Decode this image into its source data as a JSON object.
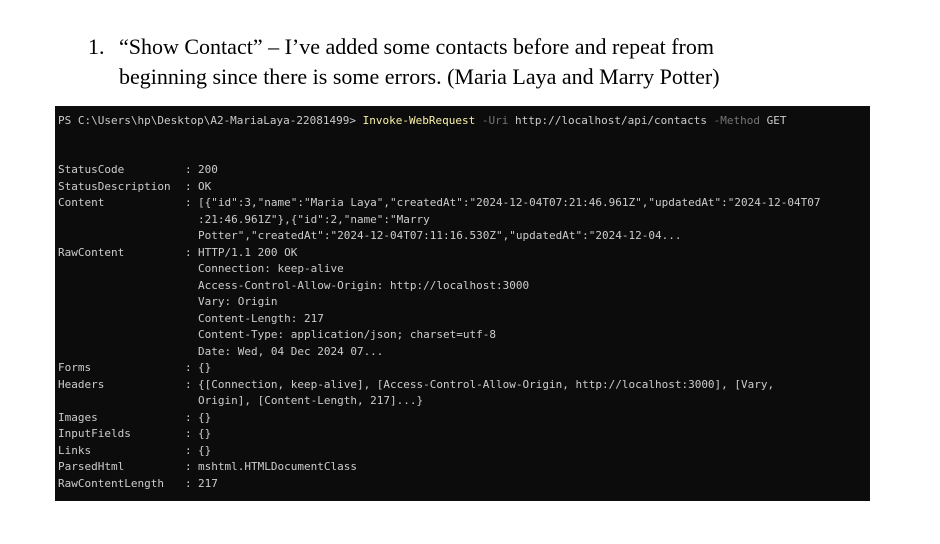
{
  "document": {
    "item_number": "1.",
    "item_line1": "“Show Contact” – I’ve added some contacts before and repeat from",
    "item_line2": "beginning since there is some errors. (Maria Laya and Marry Potter)"
  },
  "terminal": {
    "prompt": "PS C:\\Users\\hp\\Desktop\\A2-MariaLaya-22081499> ",
    "command": "Invoke-WebRequest",
    "param_uri": " -Uri ",
    "uri_value": "http://localhost/api/contacts",
    "param_method": " -Method ",
    "method_value": "GET",
    "separator": ": ",
    "rows": [
      {
        "key": "StatusCode",
        "values": [
          "200"
        ]
      },
      {
        "key": "StatusDescription",
        "values": [
          "OK"
        ]
      },
      {
        "key": "Content",
        "values": [
          "[{\"id\":3,\"name\":\"Maria Laya\",\"createdAt\":\"2024-12-04T07:21:46.961Z\",\"updatedAt\":\"2024-12-04T07",
          ":21:46.961Z\"},{\"id\":2,\"name\":\"Marry",
          "Potter\",\"createdAt\":\"2024-12-04T07:11:16.530Z\",\"updatedAt\":\"2024-12-04..."
        ]
      },
      {
        "key": "RawContent",
        "values": [
          "HTTP/1.1 200 OK",
          "Connection: keep-alive",
          "Access-Control-Allow-Origin: http://localhost:3000",
          "Vary: Origin",
          "Content-Length: 217",
          "Content-Type: application/json; charset=utf-8",
          "Date: Wed, 04 Dec 2024 07..."
        ]
      },
      {
        "key": "Forms",
        "values": [
          "{}"
        ]
      },
      {
        "key": "Headers",
        "values": [
          "{[Connection, keep-alive], [Access-Control-Allow-Origin, http://localhost:3000], [Vary,",
          "Origin], [Content-Length, 217]...}"
        ]
      },
      {
        "key": "Images",
        "values": [
          "{}"
        ]
      },
      {
        "key": "InputFields",
        "values": [
          "{}"
        ]
      },
      {
        "key": "Links",
        "values": [
          "{}"
        ]
      },
      {
        "key": "ParsedHtml",
        "values": [
          "mshtml.HTMLDocumentClass"
        ]
      },
      {
        "key": "RawContentLength",
        "values": [
          "217"
        ]
      }
    ]
  }
}
